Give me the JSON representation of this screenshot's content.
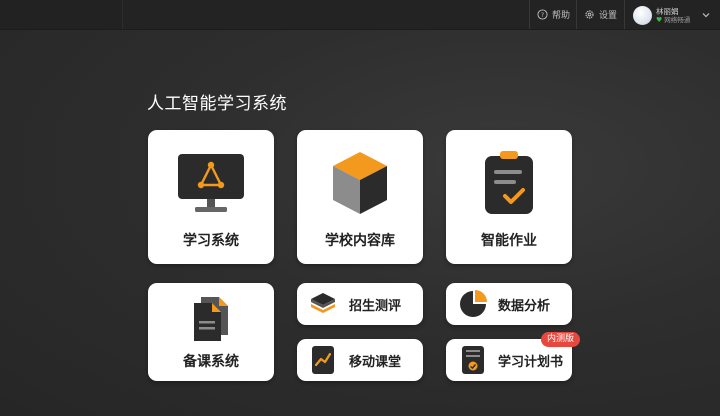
{
  "topbar": {
    "help_label": "帮助",
    "settings_label": "设置",
    "user": {
      "name": "林丽娟",
      "status": "网络畅通"
    }
  },
  "page_title": "人工智能学习系统",
  "cards": {
    "learning_system": "学习系统",
    "school_content": "学校内容库",
    "smart_homework": "智能作业",
    "lesson_prep": "备课系统",
    "admission_test": "招生测评",
    "data_analysis": "数据分析",
    "mobile_class": "移动课堂",
    "study_plan": "学习计划书",
    "study_plan_badge": "内测版"
  },
  "colors": {
    "accent": "#f39a1e",
    "dark_icon": "#2b2b2b",
    "badge": "#e8473e"
  }
}
